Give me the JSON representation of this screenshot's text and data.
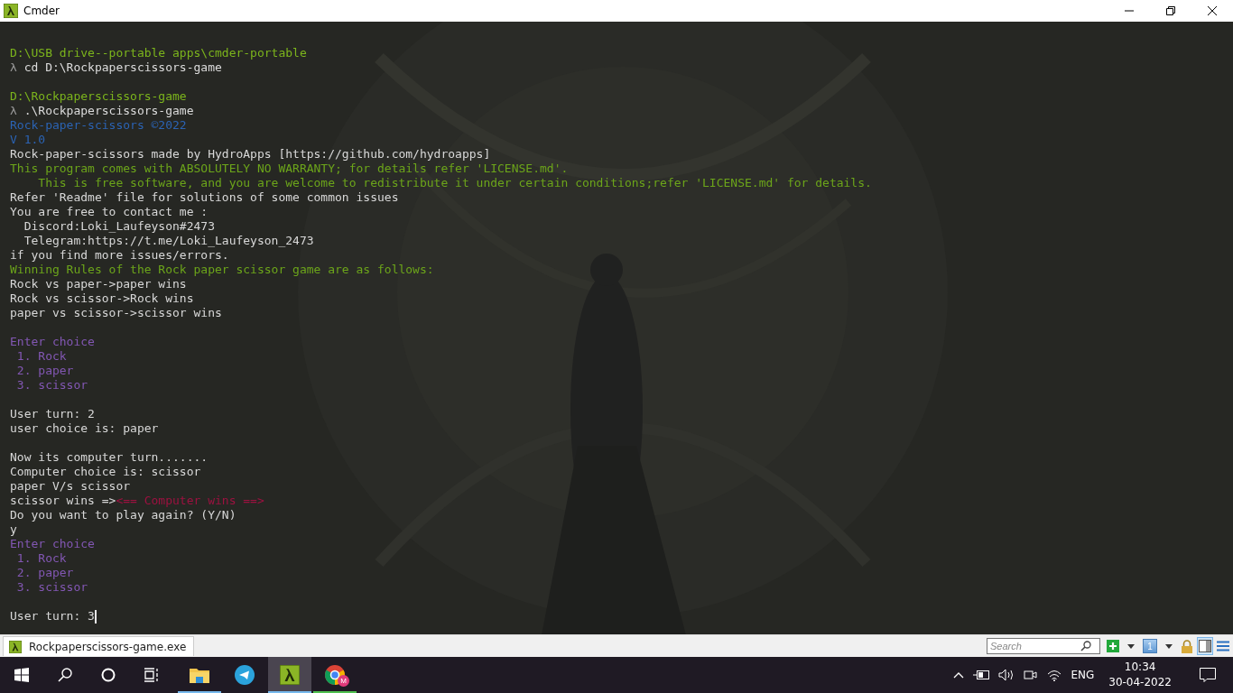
{
  "window": {
    "title": "Cmder"
  },
  "terminal": {
    "lines": [
      {
        "kind": "text",
        "segments": [
          {
            "kind": "path",
            "text": "D:\\USB drive--portable apps\\cmder-portable"
          }
        ]
      },
      {
        "kind": "text",
        "segments": [
          {
            "kind": "lambda",
            "text": "λ"
          },
          {
            "kind": "command",
            "text": " cd D:\\Rockpaperscissors-game"
          }
        ]
      },
      {
        "kind": "blank"
      },
      {
        "kind": "text",
        "segments": [
          {
            "kind": "path",
            "text": "D:\\Rockpaperscissors-game"
          }
        ]
      },
      {
        "kind": "text",
        "segments": [
          {
            "kind": "lambda",
            "text": "λ"
          },
          {
            "kind": "command",
            "text": " .\\Rockpaperscissors-game"
          }
        ]
      },
      {
        "kind": "text",
        "segments": [
          {
            "kind": "banner",
            "text": "Rock-paper-scissors ©2022"
          }
        ]
      },
      {
        "kind": "text",
        "segments": [
          {
            "kind": "banner",
            "text": "V 1.0"
          }
        ]
      },
      {
        "kind": "text",
        "segments": [
          {
            "kind": "plain",
            "text": "Rock-paper-scissors made by HydroApps [https://github.com/hydroapps]"
          }
        ]
      },
      {
        "kind": "text",
        "segments": [
          {
            "kind": "notice",
            "text": "This program comes with ABSOLUTELY NO WARRANTY; for details refer 'LICENSE.md'."
          }
        ]
      },
      {
        "kind": "text",
        "segments": [
          {
            "kind": "notice",
            "text": "    This is free software, and you are welcome to redistribute it under certain conditions;refer 'LICENSE.md' for details."
          }
        ]
      },
      {
        "kind": "text",
        "segments": [
          {
            "kind": "plain",
            "text": "Refer 'Readme' file for solutions of some common issues"
          }
        ]
      },
      {
        "kind": "text",
        "segments": [
          {
            "kind": "plain",
            "text": "You are free to contact me :"
          }
        ]
      },
      {
        "kind": "text",
        "segments": [
          {
            "kind": "plain",
            "text": "  Discord:Loki_Laufeyson#2473"
          }
        ]
      },
      {
        "kind": "text",
        "segments": [
          {
            "kind": "plain",
            "text": "  Telegram:https://t.me/Loki_Laufeyson_2473"
          }
        ]
      },
      {
        "kind": "text",
        "segments": [
          {
            "kind": "plain",
            "text": "if you find more issues/errors."
          }
        ]
      },
      {
        "kind": "text",
        "segments": [
          {
            "kind": "notice",
            "text": "Winning Rules of the Rock paper scissor game are as follows:"
          }
        ]
      },
      {
        "kind": "text",
        "segments": [
          {
            "kind": "plain",
            "text": "Rock vs paper->paper wins"
          }
        ]
      },
      {
        "kind": "text",
        "segments": [
          {
            "kind": "plain",
            "text": "Rock vs scissor->Rock wins"
          }
        ]
      },
      {
        "kind": "text",
        "segments": [
          {
            "kind": "plain",
            "text": "paper vs scissor->scissor wins"
          }
        ]
      },
      {
        "kind": "blank"
      },
      {
        "kind": "text",
        "segments": [
          {
            "kind": "menu",
            "text": "Enter choice"
          }
        ]
      },
      {
        "kind": "text",
        "segments": [
          {
            "kind": "menu",
            "text": " 1. Rock"
          }
        ]
      },
      {
        "kind": "text",
        "segments": [
          {
            "kind": "menu",
            "text": " 2. paper"
          }
        ]
      },
      {
        "kind": "text",
        "segments": [
          {
            "kind": "menu",
            "text": " 3. scissor"
          }
        ]
      },
      {
        "kind": "blank"
      },
      {
        "kind": "text",
        "segments": [
          {
            "kind": "plain",
            "text": "User turn: 2"
          }
        ]
      },
      {
        "kind": "text",
        "segments": [
          {
            "kind": "plain",
            "text": "user choice is: paper"
          }
        ]
      },
      {
        "kind": "blank"
      },
      {
        "kind": "text",
        "segments": [
          {
            "kind": "plain",
            "text": "Now its computer turn......."
          }
        ]
      },
      {
        "kind": "text",
        "segments": [
          {
            "kind": "plain",
            "text": "Computer choice is: scissor"
          }
        ]
      },
      {
        "kind": "text",
        "segments": [
          {
            "kind": "plain",
            "text": "paper V/s scissor"
          }
        ]
      },
      {
        "kind": "text",
        "segments": [
          {
            "kind": "plain",
            "text": "scissor wins =>"
          },
          {
            "kind": "result",
            "text": "<== Computer wins ==>"
          }
        ]
      },
      {
        "kind": "text",
        "segments": [
          {
            "kind": "plain",
            "text": "Do you want to play again? (Y/N)"
          }
        ]
      },
      {
        "kind": "text",
        "segments": [
          {
            "kind": "plain",
            "text": "y"
          }
        ]
      },
      {
        "kind": "text",
        "segments": [
          {
            "kind": "menu",
            "text": "Enter choice"
          }
        ]
      },
      {
        "kind": "text",
        "segments": [
          {
            "kind": "menu",
            "text": " 1. Rock"
          }
        ]
      },
      {
        "kind": "text",
        "segments": [
          {
            "kind": "menu",
            "text": " 2. paper"
          }
        ]
      },
      {
        "kind": "text",
        "segments": [
          {
            "kind": "menu",
            "text": " 3. scissor"
          }
        ]
      },
      {
        "kind": "blank"
      },
      {
        "kind": "input",
        "segments": [
          {
            "kind": "plain",
            "text": "User turn: 3"
          }
        ]
      }
    ]
  },
  "status_bar": {
    "tab": "Rockpaperscissors-game.exe",
    "search": {
      "placeholder": "Search"
    },
    "console_number": "1",
    "split_view": {
      "selected": true
    }
  },
  "taskbar": {
    "apps": [
      {
        "kind": "explorer",
        "running": true,
        "selected": false,
        "color": "#76b9ed"
      },
      {
        "kind": "telegram",
        "running": false,
        "selected": false
      },
      {
        "kind": "cmder",
        "running": true,
        "selected": true,
        "color": "#76b9ed"
      },
      {
        "kind": "chrome",
        "running": true,
        "selected": false,
        "color": "#4fc14f",
        "badge": "M"
      }
    ],
    "language": "ENG",
    "time": "10:34",
    "date": "30-04-2022"
  }
}
